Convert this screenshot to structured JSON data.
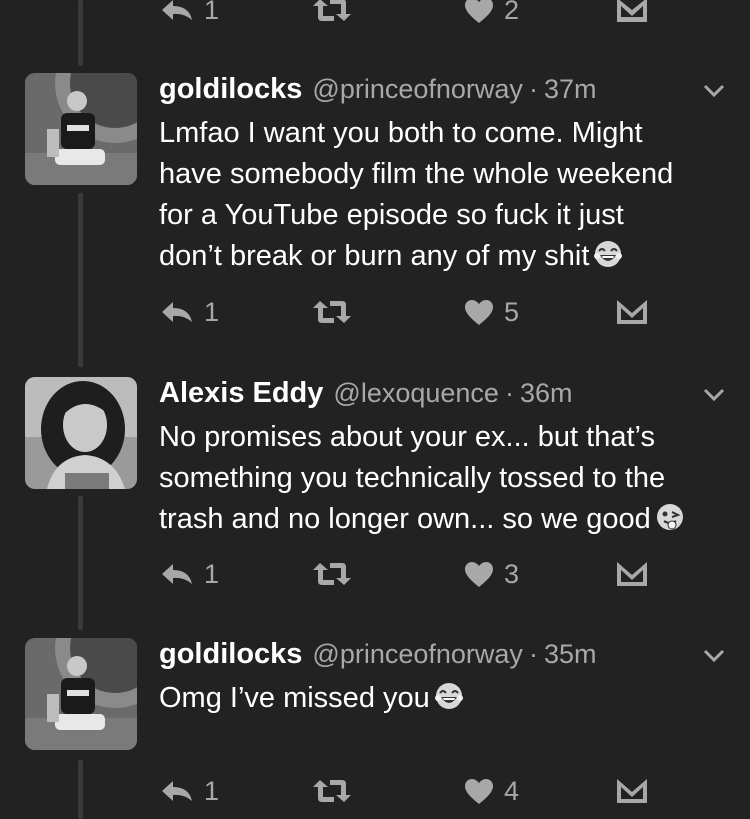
{
  "tweets": [
    {
      "name": "goldilocks",
      "handle": "@princeofnorway",
      "sep": "·",
      "time": "37m",
      "lines": [
        "Lmfao I want you both to come. Might",
        "have somebody film the whole weekend",
        "for a YouTube episode so fuck it just",
        "don’t break or burn any of my shit"
      ],
      "emoji": "tears-of-joy-emoji",
      "replies": "1",
      "retweets": "",
      "likes": "5"
    },
    {
      "name": "Alexis Eddy",
      "handle": "@lexoquence",
      "sep": "·",
      "time": "36m",
      "lines": [
        "No promises about your ex... but that’s",
        "something you technically tossed to the",
        "trash and no longer own... so we good"
      ],
      "emoji": "winking-tongue-emoji",
      "replies": "1",
      "retweets": "",
      "likes": "3"
    },
    {
      "name": "goldilocks",
      "handle": "@princeofnorway",
      "sep": "·",
      "time": "35m",
      "lines": [
        "Omg I’ve missed you"
      ],
      "emoji": "tears-of-joy-emoji",
      "replies": "1",
      "retweets": "",
      "likes": "4"
    }
  ],
  "previous_tweet_actions": {
    "replies": "1",
    "likes": "2"
  },
  "colors": {
    "background": "#222222",
    "text": "#ffffff",
    "muted": "#a8a8a8",
    "thread_line": "#3a3a3a"
  }
}
